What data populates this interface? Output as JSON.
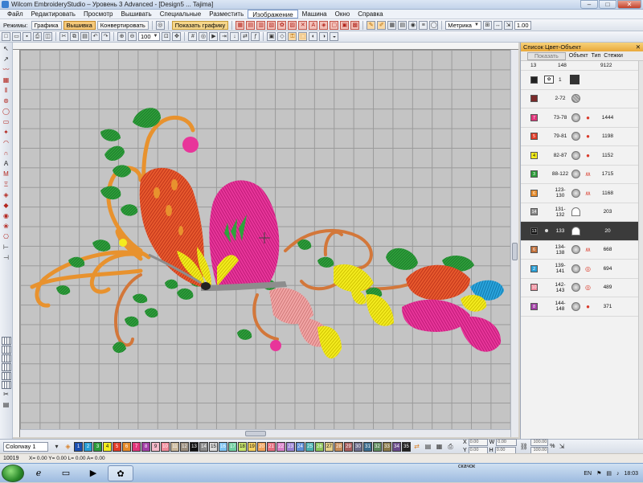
{
  "window": {
    "title": "Wilcom EmbroideryStudio – Уровень 3 Advanced - [Design5 ... Tajima]",
    "controls": [
      "–",
      "□",
      "✕"
    ]
  },
  "menu": [
    "Файл",
    "Редактировать",
    "Просмотр",
    "Вышивать",
    "Специальные",
    "Разместить",
    "Изображение",
    "Машина",
    "Окно",
    "Справка"
  ],
  "menu_active": "Изображение",
  "toolbar1": {
    "mode_label": "Режимы:",
    "mode_graphics": "Графика",
    "mode_embroidery": "Вышивка",
    "convert": "Конвертировать",
    "show_graphic": "Показать графику",
    "units": "Метрика",
    "zoom": "1.00"
  },
  "toolbar2": {
    "zoom_percent": "100"
  },
  "right_panel": {
    "title": "Список Цвет-Объект",
    "show_button": "Показать",
    "col_object": "Объект",
    "col_type": "Тип",
    "col_stitches": "Стежки",
    "header_row": {
      "a": "13",
      "b": "148",
      "c": "9122"
    },
    "image_row": {
      "num": "1"
    },
    "range_row": {
      "range": "2-72"
    },
    "rows": [
      {
        "num": "7",
        "color": "#e0357a",
        "range": "73-78",
        "stitches": "1444",
        "type": "fill"
      },
      {
        "num": "5",
        "color": "#e03b27",
        "range": "79-81",
        "stitches": "1198",
        "type": "fill"
      },
      {
        "num": "4",
        "color": "#f3ec1c",
        "range": "82-87",
        "stitches": "1152",
        "type": "fill"
      },
      {
        "num": "3",
        "color": "#2d9b3a",
        "range": "88-122",
        "stitches": "1715",
        "type": "satin"
      },
      {
        "num": "6",
        "color": "#e58a2a",
        "range": "123-130",
        "stitches": "1168",
        "type": "satin"
      },
      {
        "num": "14",
        "color": "#8c8c8c",
        "range": "131-132",
        "stitches": "203",
        "type": "run"
      },
      {
        "num": "13",
        "color": "#111111",
        "range": "133",
        "stitches": "20",
        "type": "run"
      },
      {
        "num": "6",
        "color": "#c2703a",
        "range": "134-138",
        "stitches": "668",
        "type": "satin"
      },
      {
        "num": "2",
        "color": "#2a9fd6",
        "range": "139-141",
        "stitches": "694",
        "type": "fill2"
      },
      {
        "num": "10",
        "color": "#f08a9a",
        "range": "142-143",
        "stitches": "489",
        "type": "fill2"
      },
      {
        "num": "8",
        "color": "#a23fa6",
        "range": "144-148",
        "stitches": "371",
        "type": "fill"
      }
    ]
  },
  "colorbar": {
    "colorway": "Colorway 1",
    "swatches": [
      {
        "n": "1",
        "c": "#1b4fb0"
      },
      {
        "n": "2",
        "c": "#2a9fd6"
      },
      {
        "n": "3",
        "c": "#2d9b3a"
      },
      {
        "n": "4",
        "c": "#f3ec1c"
      },
      {
        "n": "5",
        "c": "#e03b27"
      },
      {
        "n": "6",
        "c": "#e58a2a"
      },
      {
        "n": "7",
        "c": "#e0357a"
      },
      {
        "n": "8",
        "c": "#a23fa6"
      },
      {
        "n": "9",
        "c": "#f5b9c8"
      },
      {
        "n": "10",
        "c": "#f08a9a"
      },
      {
        "n": "11",
        "c": "#c9b79a"
      },
      {
        "n": "12",
        "c": "#9b8e7e"
      },
      {
        "n": "13",
        "c": "#111111"
      },
      {
        "n": "14",
        "c": "#8c8c8c"
      },
      {
        "n": "15",
        "c": "#d9d9d9"
      },
      {
        "n": "16",
        "c": "#7ec2ef"
      },
      {
        "n": "17",
        "c": "#6fcfa0"
      },
      {
        "n": "18",
        "c": "#c7e36b"
      },
      {
        "n": "19",
        "c": "#f4cf5e"
      },
      {
        "n": "20",
        "c": "#f1a25b"
      },
      {
        "n": "21",
        "c": "#e56e7f"
      },
      {
        "n": "22",
        "c": "#d97fc8"
      },
      {
        "n": "23",
        "c": "#9a83d4"
      },
      {
        "n": "24",
        "c": "#5f8fd6"
      },
      {
        "n": "25",
        "c": "#4ab0b0"
      },
      {
        "n": "26",
        "c": "#8cc45a"
      },
      {
        "n": "27",
        "c": "#e4d08a"
      },
      {
        "n": "28",
        "c": "#c68b59"
      },
      {
        "n": "29",
        "c": "#a85d5d"
      },
      {
        "n": "30",
        "c": "#6e6e8c"
      },
      {
        "n": "31",
        "c": "#3c6e8f"
      },
      {
        "n": "32",
        "c": "#5c8a5c"
      },
      {
        "n": "33",
        "c": "#8a7a4a"
      },
      {
        "n": "34",
        "c": "#6a4a8a"
      },
      {
        "n": "35",
        "c": "#222222"
      }
    ],
    "x_label": "X",
    "y_label": "Y",
    "w_label": "W",
    "h_label": "H",
    "x_val": "0.00",
    "y_val": "0.00",
    "w_val": "0.00",
    "h_val": "0.00",
    "pct_w": "100.00",
    "pct_h": "100.00",
    "pct_sign": "%"
  },
  "status": {
    "stitch_count": "10019",
    "coords": "X= 0.00 Y= 0.00 L= 0.00 A= 0.00"
  },
  "taskbar": {
    "download_label": "скачок",
    "lang": "EN",
    "clock": "18:03"
  }
}
